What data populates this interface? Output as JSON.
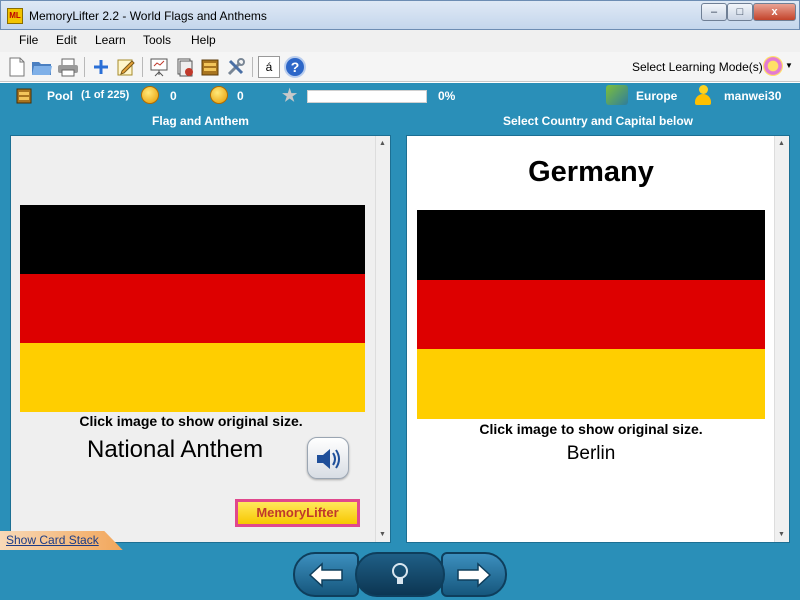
{
  "window": {
    "app_icon_text": "ML",
    "title": "MemoryLifter 2.2 - World Flags and Anthems",
    "min_glyph": "–",
    "max_glyph": "□",
    "close_glyph": "x"
  },
  "menu": [
    "File",
    "Edit",
    "Learn",
    "Tools",
    "Help"
  ],
  "toolbar": {
    "select_mode_label": "Select Learning Mode(s)",
    "special_char_glyph": "á",
    "help_glyph": "?",
    "icons": [
      "new-file-icon",
      "open-folder-icon",
      "print-icon",
      "add-card-icon",
      "edit-card-icon",
      "presentation-icon",
      "card-stack-icon",
      "box-icon",
      "tools-icon",
      "special-characters-icon",
      "help-icon",
      "learning-mode-icon"
    ]
  },
  "status": {
    "pool_label": "Pool",
    "pool_count": "(1 of 225)",
    "right_count": "0",
    "wrong_count": "0",
    "progress_percent": "0%",
    "progress_value": 0,
    "chapter": "Europe",
    "user": "manwei30"
  },
  "left_pane": {
    "header": "Flag and Anthem",
    "caption": "Click image to show original size.",
    "anthem_label": "National Anthem",
    "logo_text": "MemoryLifter"
  },
  "right_pane": {
    "header": "Select Country and Capital below",
    "country": "Germany",
    "caption": "Click image to show original size.",
    "capital": "Berlin"
  },
  "flag_colors": [
    "#000000",
    "#DD0000",
    "#FFCE00"
  ],
  "bottom": {
    "show_card_stack": "Show Card Stack"
  }
}
